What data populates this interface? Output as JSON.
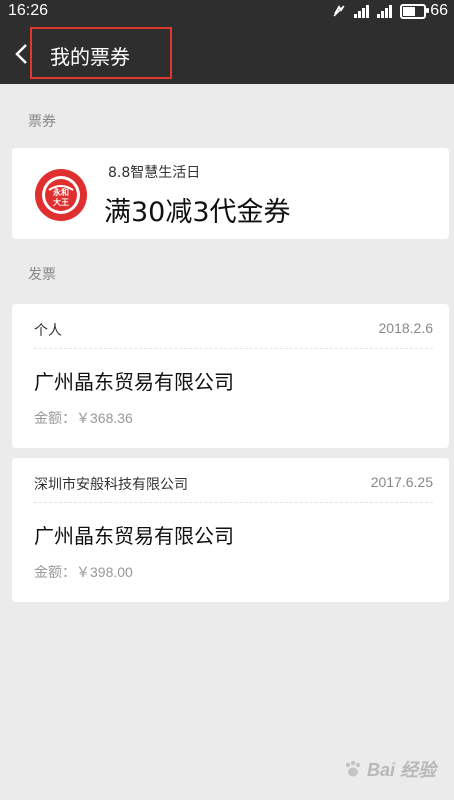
{
  "status_bar": {
    "time": "16:26",
    "battery": "66",
    "battery_level": 0.66
  },
  "header": {
    "title": "我的票券",
    "back_icon": "chevron-left-icon",
    "highlight_color": "#e0382c"
  },
  "coupons": {
    "section_label": "票券",
    "items": [
      {
        "logo_icon": "brand-logo-icon",
        "logo_text": "永和大王",
        "subtitle": "8.8智慧生活日",
        "title": "满30减3代金券"
      }
    ]
  },
  "invoices": {
    "section_label": "发票",
    "amount_label": "金额：",
    "items": [
      {
        "buyer": "个人",
        "date": "2018.2.6",
        "seller": "广州晶东贸易有限公司",
        "amount": "￥368.36"
      },
      {
        "buyer": "深圳市安般科技有限公司",
        "date": "2017.6.25",
        "seller": "广州晶东贸易有限公司",
        "amount": "￥398.00"
      }
    ]
  },
  "watermark": {
    "text": "Bai 经验",
    "icon": "paw-icon"
  }
}
